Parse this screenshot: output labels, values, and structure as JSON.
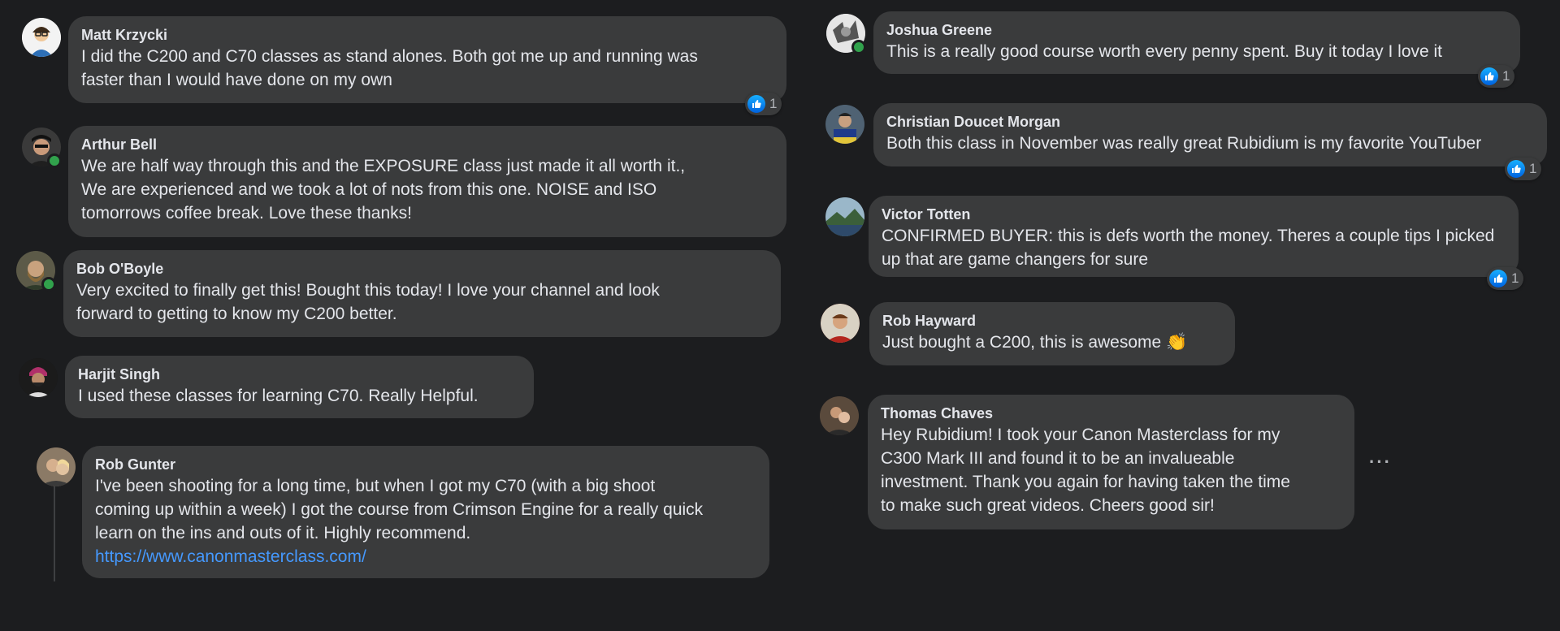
{
  "accent": {
    "online": "#31a24c",
    "like_blue": "#1877f2",
    "link": "#4599ff"
  },
  "left_comments": [
    {
      "author": "Matt Krzycki",
      "lines": [
        "I did the C200 and C70 classes as stand alones. Both got me up and running was",
        "faster than I would have done on my own"
      ],
      "reaction_count": "1",
      "online": false
    },
    {
      "author": "Arthur Bell",
      "lines": [
        "We are half way through this and the EXPOSURE class just made it all worth it.,",
        "We are experienced and we took a lot of nots from this one. NOISE and ISO",
        "tomorrows coffee break. Love these thanks!"
      ],
      "online": true
    },
    {
      "author": "Bob O'Boyle",
      "lines": [
        "Very excited to finally get this! Bought this today! I love your channel and look",
        "forward to getting to know my C200 better."
      ],
      "online": true
    },
    {
      "author": "Harjit Singh",
      "lines": [
        "I used these classes for learning C70. Really Helpful."
      ],
      "online": false
    },
    {
      "author": "Rob Gunter",
      "lines": [
        "I've been shooting for a long time, but when I got my C70 (with a big shoot",
        "coming up within a week) I got the course from Crimson Engine for a really quick",
        "learn on the ins and outs of it. Highly recommend."
      ],
      "link": "https://www.canonmasterclass.com/",
      "online": false
    }
  ],
  "right_comments": [
    {
      "author": "Joshua Greene",
      "lines": [
        "This is a really good course worth every penny spent. Buy it today I love it"
      ],
      "reaction_count": "1",
      "online": true
    },
    {
      "author": "Christian Doucet Morgan",
      "lines": [
        "Both this class in November was really great Rubidium is my favorite YouTuber"
      ],
      "reaction_count": "1",
      "online": false
    },
    {
      "author": "Victor Totten",
      "lines": [
        "CONFIRMED BUYER: this is defs worth the money. Theres a couple tips I picked",
        "up that are game changers for sure"
      ],
      "reaction_count": "1",
      "online": false
    },
    {
      "author": "Rob Hayward",
      "lines": [
        "Just bought a C200, this is awesome"
      ],
      "emoji": "👏",
      "online": false
    },
    {
      "author": "Thomas Chaves",
      "lines": [
        "Hey Rubidium! I took your Canon Masterclass for my",
        "C300 Mark III and found it to be an invalueable",
        "investment. Thank you again for having taken the time",
        "to make such great videos. Cheers good sir!"
      ],
      "more_label": "···",
      "online": false
    }
  ],
  "icons": {
    "reaction": "like-thumbs-up-icon",
    "more": "more-options-icon",
    "status": "online-status-icon"
  }
}
